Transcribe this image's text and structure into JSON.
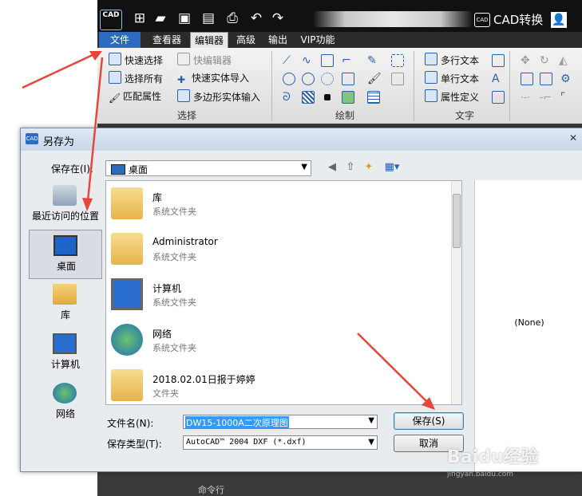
{
  "app": {
    "logo_text": "CAD",
    "title": "CAD转换",
    "menu": [
      "文件",
      "查看器",
      "编辑器",
      "高级",
      "输出",
      "VIP功能"
    ],
    "active_menu": "编辑器"
  },
  "ribbon": {
    "select_group": {
      "label": "选择",
      "items": [
        "快速选择",
        "选择所有",
        "匹配属性",
        "快编辑器",
        "快速实体导入",
        "多边形实体输入"
      ]
    },
    "draw_group": {
      "label": "绘制"
    },
    "text_group": {
      "label": "文字",
      "items": [
        "多行文本",
        "单行文本",
        "属性定义"
      ]
    }
  },
  "dialog": {
    "title": "另存为",
    "save_in_label": "保存在(I):",
    "location": "桌面",
    "places": [
      "最近访问的位置",
      "桌面",
      "库",
      "计算机",
      "网络"
    ],
    "selected_place": "桌面",
    "files": [
      {
        "name": "库",
        "type": "系统文件夹"
      },
      {
        "name": "Administrator",
        "type": "系统文件夹"
      },
      {
        "name": "计算机",
        "type": "系统文件夹"
      },
      {
        "name": "网络",
        "type": "系统文件夹"
      },
      {
        "name": "2018.02.01日报于婷婷",
        "type": "文件夹"
      }
    ],
    "filename_label": "文件名(N):",
    "filename_value": "DW15-1000A二次原理图",
    "filetype_label": "保存类型(T):",
    "filetype_value": "AutoCAD™ 2004 DXF (*.dxf)",
    "save_button": "保存(S)",
    "cancel_button": "取消",
    "preview_text": "(None)"
  },
  "watermark": "Baidu经验",
  "watermark_sub": "jingyan.baidu.com",
  "bottom_text": "命令行",
  "colors": {
    "accent": "#2c6bc0",
    "arrow": "#e8463a",
    "titlebar": "#111111"
  }
}
